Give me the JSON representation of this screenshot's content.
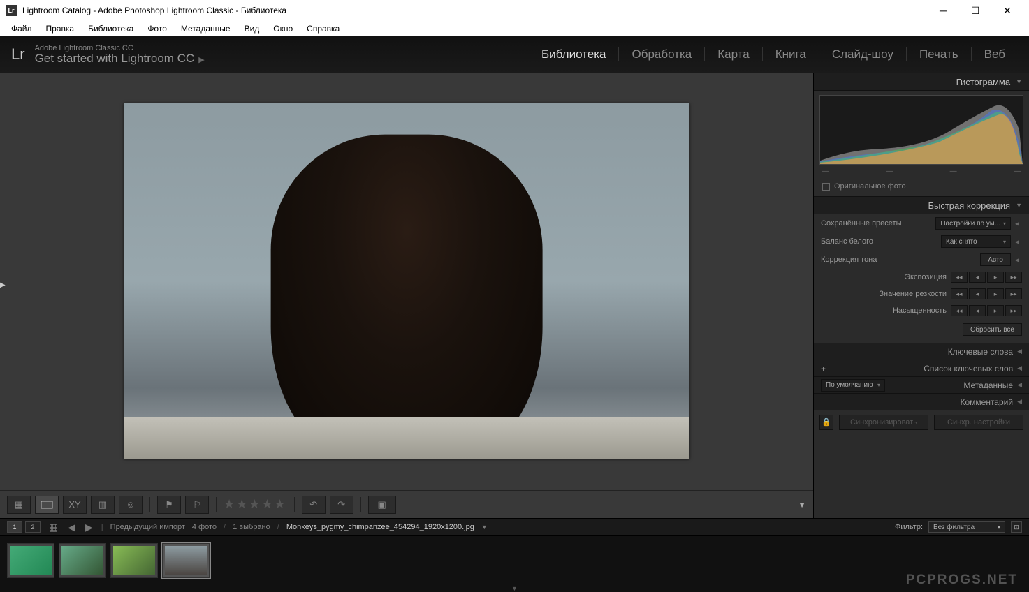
{
  "window": {
    "title": "Lightroom Catalog - Adobe Photoshop Lightroom Classic - Библиотека"
  },
  "menubar": [
    "Файл",
    "Правка",
    "Библиотека",
    "Фото",
    "Метаданные",
    "Вид",
    "Окно",
    "Справка"
  ],
  "brand": {
    "logo": "Lr",
    "line1": "Adobe Lightroom Classic CC",
    "line2": "Get started with Lightroom CC"
  },
  "modules": [
    {
      "label": "Библиотека",
      "active": true
    },
    {
      "label": "Обработка",
      "active": false
    },
    {
      "label": "Карта",
      "active": false
    },
    {
      "label": "Книга",
      "active": false
    },
    {
      "label": "Слайд-шоу",
      "active": false
    },
    {
      "label": "Печать",
      "active": false
    },
    {
      "label": "Веб",
      "active": false
    }
  ],
  "right": {
    "histogram_title": "Гистограмма",
    "original_photo": "Оригинальное фото",
    "quick": {
      "title": "Быстрая коррекция",
      "preset_label": "Сохранённые пресеты",
      "preset_value": "Настройки по ум...",
      "wb_label": "Баланс белого",
      "wb_value": "Как снято",
      "tone_label": "Коррекция тона",
      "auto": "Авто",
      "exposure": "Экспозиция",
      "clarity": "Значение резкости",
      "saturation": "Насыщенность",
      "reset": "Сбросить всё"
    },
    "keywords_title": "Ключевые слова",
    "keyword_list_title": "Список ключевых слов",
    "metadata_title": "Метаданные",
    "metadata_mode": "По умолчанию",
    "comments_title": "Комментарий",
    "sync": {
      "btn1": "Синхронизировать",
      "btn2": "Синхр. настройки"
    }
  },
  "filmbar": {
    "screen1": "1",
    "screen2": "2",
    "breadcrumb": "Предыдущий импорт",
    "count": "4 фото",
    "selected": "1 выбрано",
    "filename": "Monkeys_pygmy_chimpanzee_454294_1920x1200.jpg",
    "filter_label": "Фильтр:",
    "filter_value": "Без фильтра"
  },
  "watermark": "PCPROGS.NET"
}
